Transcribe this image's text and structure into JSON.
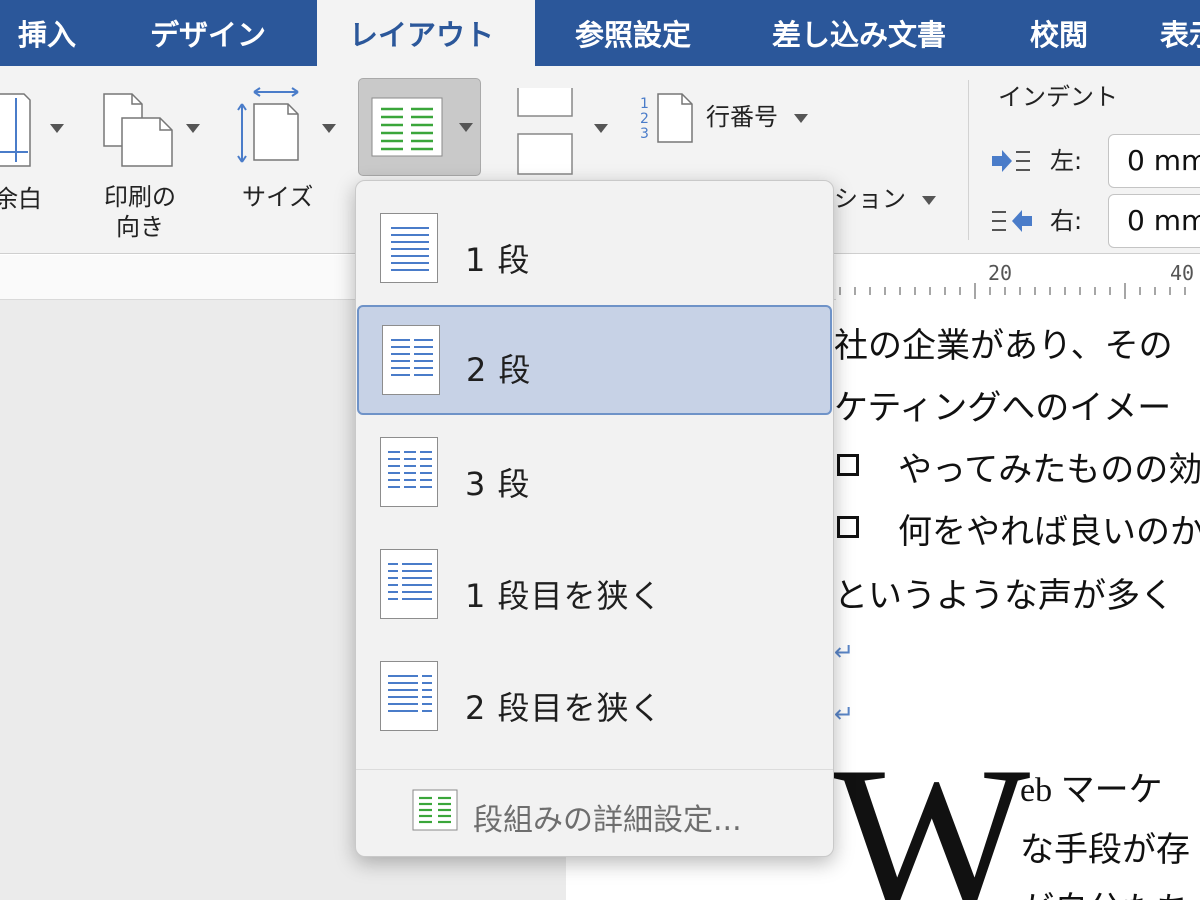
{
  "tabs": [
    {
      "label": "挿入"
    },
    {
      "label": "デザイン"
    },
    {
      "label": "レイアウト"
    },
    {
      "label": "参照設定"
    },
    {
      "label": "差し込み文書"
    },
    {
      "label": "校閲"
    },
    {
      "label": "表示"
    }
  ],
  "ribbon": {
    "margins_label": "余白",
    "orientation_label": "印刷の\n向き",
    "size_label": "サイズ",
    "columns_icon": "columns-icon",
    "line_numbers_label": "行番号",
    "hyphenation_label": "ション",
    "indent": {
      "title": "インデント",
      "left_label": "左:",
      "left_value": "0 mm",
      "right_label": "右:",
      "right_value": "0 mm"
    }
  },
  "ruler": {
    "labels": [
      "20",
      "40"
    ]
  },
  "document": {
    "lines": [
      "社の企業があり、その",
      "ケティングへのイメー",
      "やってみたものの効",
      "何をやれば良いのか",
      "というような声が多く"
    ],
    "return_mark": "↵",
    "dropcap": "W",
    "para_lines": [
      "eb マーケ",
      "な手段が存",
      "が自分たち"
    ]
  },
  "columns_menu": {
    "items": [
      {
        "label": "1 段",
        "cols": 1,
        "selected": false
      },
      {
        "label": "2 段",
        "cols": 2,
        "selected": true
      },
      {
        "label": "3 段",
        "cols": 3,
        "selected": false
      },
      {
        "label": "1 段目を狭く",
        "cols": "left",
        "selected": false
      },
      {
        "label": "2 段目を狭く",
        "cols": "right",
        "selected": false
      }
    ],
    "footer_label": "段組みの詳細設定..."
  },
  "colors": {
    "tab_bar": "#2b579a",
    "accent_blue": "#4a7cc9",
    "column_icon_green": "#3aa63a",
    "selected_item": "#c7d2e6"
  }
}
